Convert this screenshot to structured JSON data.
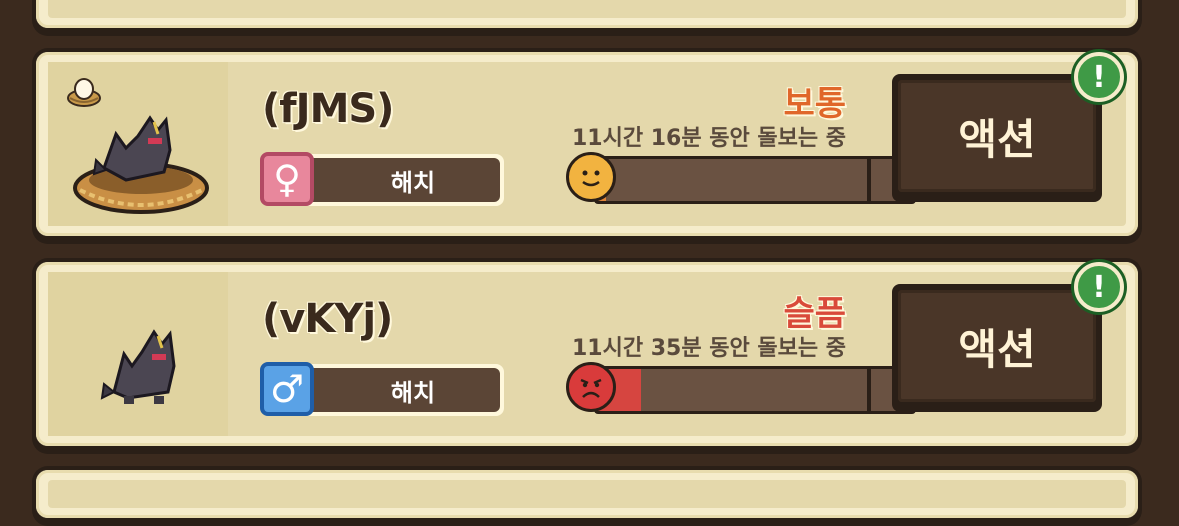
{
  "pets": [
    {
      "name": "(fJMS)",
      "gender": "female",
      "gender_symbol": "♀",
      "status_label": "해치",
      "mood_label": "보통",
      "mood_color": "#e0672a",
      "care_text": "11시간 16분 동안 돌보는 중",
      "mood_fill_percent": 3,
      "mood_fill_color": "#e0853a",
      "mood_face": "neutral",
      "action_label": "액션",
      "alert_symbol": "!",
      "has_egg_icon": true,
      "has_nest": true
    },
    {
      "name": "(vKYj)",
      "gender": "male",
      "gender_symbol": "♂",
      "status_label": "해치",
      "mood_label": "슬픔",
      "mood_color": "#d94a3a",
      "care_text": "11시간 35분 동안 돌보는 중",
      "mood_fill_percent": 14,
      "mood_fill_color": "#d64540",
      "mood_face": "sad",
      "action_label": "액션",
      "alert_symbol": "!",
      "has_egg_icon": false,
      "has_nest": false
    }
  ]
}
